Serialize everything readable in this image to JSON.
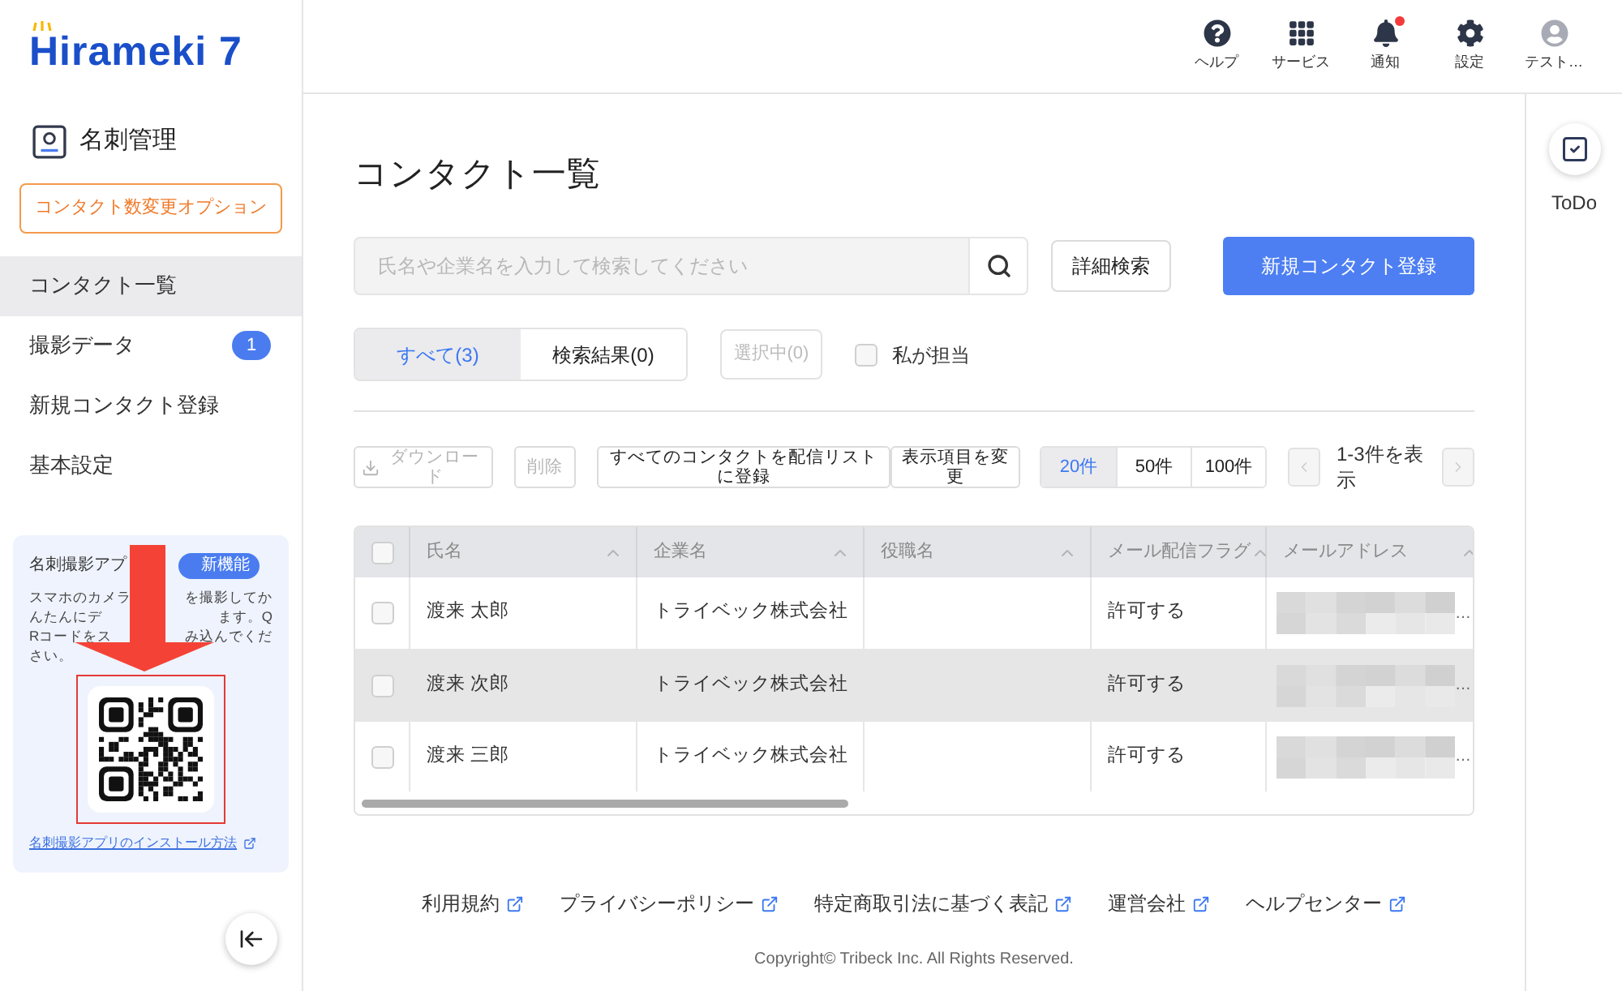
{
  "logo": {
    "text": "Hirameki 7"
  },
  "header": {
    "items": [
      {
        "kind": "help",
        "label": "ヘルプ",
        "alert": false
      },
      {
        "kind": "services",
        "label": "サービス",
        "alert": false
      },
      {
        "kind": "notifications",
        "label": "通知",
        "alert": true
      },
      {
        "kind": "settings",
        "label": "設定",
        "alert": false
      },
      {
        "kind": "account",
        "label": "テスト…",
        "alert": false
      }
    ]
  },
  "sidebar": {
    "section": "名刺管理",
    "option_button": "コンタクト数変更オプション",
    "items": [
      {
        "label": "コンタクト一覧",
        "selected": true
      },
      {
        "label": "撮影データ",
        "selected": false,
        "count": "1"
      },
      {
        "label": "新規コンタクト登録",
        "selected": false
      },
      {
        "label": "基本設定",
        "selected": false
      }
    ],
    "promo": {
      "title": "名刺撮影アプ",
      "badge": "新機能",
      "lines": [
        {
          "left": "スマホのカメラ",
          "right": "を撮影してか"
        },
        {
          "left": "んたんにデ",
          "right": "ます。Q"
        },
        {
          "left": "Rコードをス",
          "right": "み込んでくだ"
        },
        {
          "left": "さい。"
        }
      ],
      "link": "名刺撮影アプリのインストール方法"
    }
  },
  "page": {
    "title": "コンタクト一覧",
    "search": {
      "placeholder": "氏名や企業名を入力して検索してください"
    },
    "advanced_search": "詳細検索",
    "new_contact": "新規コンタクト登録",
    "filter_tabs": [
      {
        "label": "すべて(3)",
        "selected": true
      },
      {
        "label": "検索結果(0)",
        "selected": false
      }
    ],
    "selected_count": {
      "label": "選択中(0)",
      "disabled": true
    },
    "mine": {
      "label": "私が担当",
      "checked": false
    },
    "actions": [
      {
        "kind": "download",
        "label": "ダウンロード",
        "disabled": true
      },
      {
        "kind": "plain",
        "label": "削除",
        "disabled": true
      },
      {
        "kind": "plain",
        "label": "すべてのコンタクトを配信リストに登録",
        "disabled": false
      },
      {
        "kind": "plain",
        "label": "表示項目を変更",
        "disabled": false
      }
    ],
    "page_sizes": [
      {
        "label": "20件",
        "selected": true
      },
      {
        "label": "50件",
        "selected": false
      },
      {
        "label": "100件",
        "selected": false
      }
    ],
    "prev_disabled": true,
    "next_disabled": true,
    "range": "1-3件を表示",
    "table": {
      "header_checked": false,
      "columns": [
        "氏名",
        "企業名",
        "役職名",
        "メール配信フラグ",
        "メールアドレス"
      ],
      "rows": [
        {
          "checked": false,
          "highlighted": false,
          "name": "渡来 太郎",
          "company": "トライベック株式会社",
          "mail_flag": "許可する",
          "email_tail": "…"
        },
        {
          "checked": false,
          "highlighted": true,
          "name": "渡来 次郎",
          "company": "トライベック株式会社",
          "mail_flag": "許可する",
          "email_tail": "…"
        },
        {
          "checked": false,
          "highlighted": false,
          "name": "渡来 三郎",
          "company": "トライベック株式会社",
          "mail_flag": "許可する",
          "email_tail": "…"
        }
      ]
    }
  },
  "footer": {
    "links": [
      "利用規約",
      "プライバシーポリシー",
      "特定商取引法に基づく表記",
      "運営会社",
      "ヘルプセンター"
    ],
    "copyright": "Copyright© Tribeck Inc. All Rights Reserved."
  },
  "todo": {
    "label": "ToDo"
  }
}
